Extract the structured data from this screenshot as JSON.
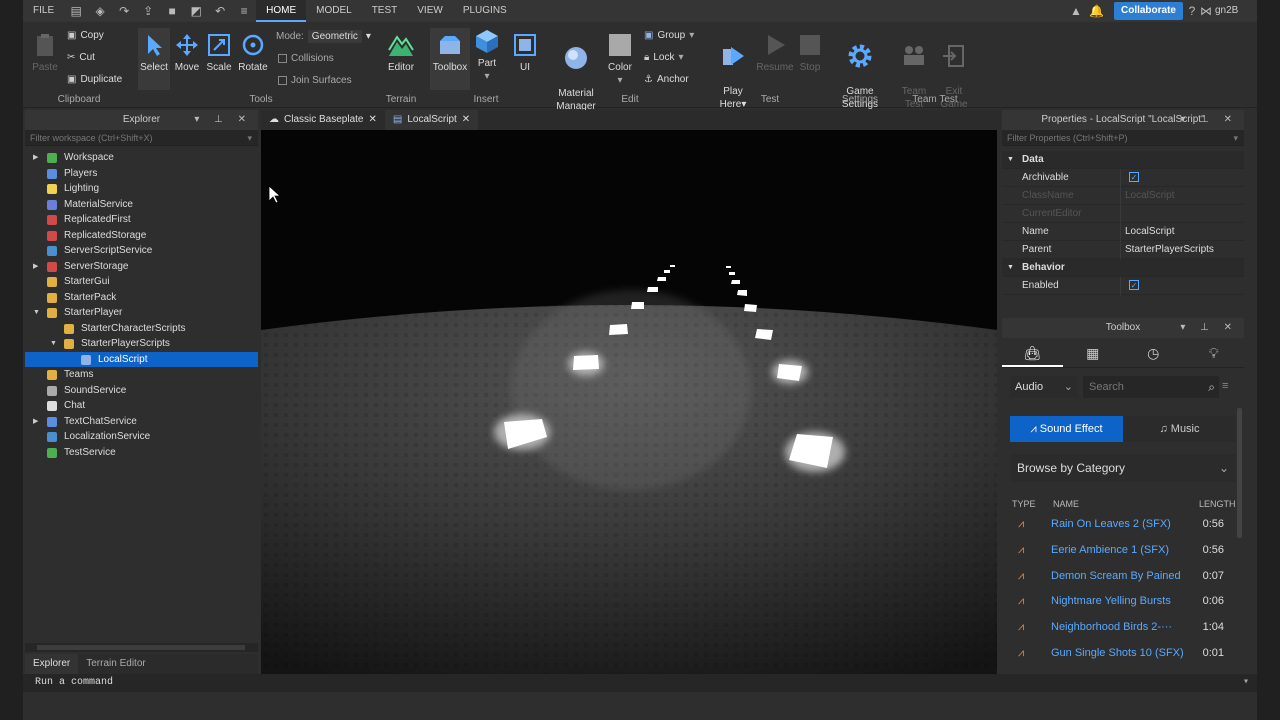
{
  "menu": {
    "items": [
      "FILE",
      "HOME",
      "MODEL",
      "TEST",
      "VIEW",
      "PLUGINS"
    ],
    "active": "HOME",
    "collaborate": "Collaborate",
    "user": "gn2B"
  },
  "ribbon": {
    "clipboard": {
      "label": "Clipboard",
      "paste": "Paste",
      "copy": "Copy",
      "cut": "Cut",
      "duplicate": "Duplicate"
    },
    "tools": {
      "label": "Tools",
      "select": "Select",
      "move": "Move",
      "scale": "Scale",
      "rotate": "Rotate",
      "mode_label": "Mode:",
      "mode_value": "Geometric",
      "collisions": "Collisions",
      "join_surfaces": "Join Surfaces"
    },
    "terrain": {
      "label": "Terrain",
      "editor": "Editor"
    },
    "insert": {
      "label": "Insert",
      "toolbox": "Toolbox",
      "part": "Part",
      "ui": "UI"
    },
    "edit": {
      "label": "Edit",
      "material": "Material\nManager",
      "color": "Color",
      "group": "Group",
      "lock": "Lock",
      "anchor": "Anchor"
    },
    "test": {
      "label": "Test",
      "play": "Play\nHere",
      "resume": "Resume",
      "stop": "Stop"
    },
    "settings": {
      "label": "Settings",
      "game_settings": "Game\nSettings"
    },
    "team_test": {
      "label": "Team Test",
      "team_test": "Team\nTest",
      "exit_game": "Exit\nGame"
    }
  },
  "explorer": {
    "title": "Explorer",
    "filter_placeholder": "Filter workspace (Ctrl+Shift+X)",
    "items": [
      {
        "label": "Workspace",
        "indent": 0,
        "arrow": "right",
        "color": "#4caf50"
      },
      {
        "label": "Players",
        "indent": 0,
        "arrow": "",
        "color": "#5b8de0"
      },
      {
        "label": "Lighting",
        "indent": 0,
        "arrow": "",
        "color": "#f0d050"
      },
      {
        "label": "MaterialService",
        "indent": 0,
        "arrow": "",
        "color": "#6a7fd8"
      },
      {
        "label": "ReplicatedFirst",
        "indent": 0,
        "arrow": "",
        "color": "#d04a4a"
      },
      {
        "label": "ReplicatedStorage",
        "indent": 0,
        "arrow": "",
        "color": "#d04a4a"
      },
      {
        "label": "ServerScriptService",
        "indent": 0,
        "arrow": "",
        "color": "#4a8fd0"
      },
      {
        "label": "ServerStorage",
        "indent": 0,
        "arrow": "right",
        "color": "#d04a4a"
      },
      {
        "label": "StarterGui",
        "indent": 0,
        "arrow": "",
        "color": "#e0b040"
      },
      {
        "label": "StarterPack",
        "indent": 0,
        "arrow": "",
        "color": "#e0b040"
      },
      {
        "label": "StarterPlayer",
        "indent": 0,
        "arrow": "down",
        "color": "#e0b040"
      },
      {
        "label": "StarterCharacterScripts",
        "indent": 1,
        "arrow": "",
        "color": "#e0b040"
      },
      {
        "label": "StarterPlayerScripts",
        "indent": 1,
        "arrow": "down",
        "color": "#e0b040"
      },
      {
        "label": "LocalScript",
        "indent": 2,
        "arrow": "",
        "color": "#8fb4e8",
        "selected": true
      },
      {
        "label": "Teams",
        "indent": 0,
        "arrow": "",
        "color": "#e0b040"
      },
      {
        "label": "SoundService",
        "indent": 0,
        "arrow": "",
        "color": "#aaaaaa"
      },
      {
        "label": "Chat",
        "indent": 0,
        "arrow": "",
        "color": "#dddddd"
      },
      {
        "label": "TextChatService",
        "indent": 0,
        "arrow": "right",
        "color": "#5b8de0"
      },
      {
        "label": "LocalizationService",
        "indent": 0,
        "arrow": "",
        "color": "#4a8fd0"
      },
      {
        "label": "TestService",
        "indent": 0,
        "arrow": "",
        "color": "#4caf50"
      }
    ],
    "bottom_tabs": [
      "Explorer",
      "Terrain Editor"
    ]
  },
  "editor_tabs": [
    {
      "label": "Classic Baseplate",
      "icon": "cloud-icon"
    },
    {
      "label": "LocalScript",
      "icon": "script-icon",
      "active": true
    }
  ],
  "properties": {
    "title": "Properties - LocalScript \"LocalScript\"",
    "filter_placeholder": "Filter Properties (Ctrl+Shift+P)",
    "rows": [
      {
        "type": "cat",
        "label": "Data"
      },
      {
        "type": "prop",
        "key": "Archivable",
        "value": "",
        "check": true
      },
      {
        "type": "prop",
        "key": "ClassName",
        "value": "LocalScript",
        "dim": true
      },
      {
        "type": "prop",
        "key": "CurrentEditor",
        "value": "",
        "dim": true
      },
      {
        "type": "prop",
        "key": "Name",
        "value": "LocalScript"
      },
      {
        "type": "prop",
        "key": "Parent",
        "value": "StarterPlayerScripts"
      },
      {
        "type": "cat",
        "label": "Behavior"
      },
      {
        "type": "prop",
        "key": "Enabled",
        "value": "",
        "check": true
      }
    ]
  },
  "toolbox": {
    "title": "Toolbox",
    "category": "Audio",
    "search_placeholder": "Search",
    "sound_effect": "Sound Effect",
    "music": "Music",
    "browse": "Browse by Category",
    "col_type": "TYPE",
    "col_name": "NAME",
    "col_length": "LENGTH",
    "sounds": [
      {
        "name": "Rain On Leaves 2 (SFX)",
        "length": "0:56"
      },
      {
        "name": "Eerie Ambience 1 (SFX)",
        "length": "0:56"
      },
      {
        "name": "Demon Scream By Pained",
        "length": "0:07"
      },
      {
        "name": "Nightmare Yelling Bursts",
        "length": "0:06"
      },
      {
        "name": "Neighborhood Birds 2-···",
        "length": "1:04"
      },
      {
        "name": "Gun Single Shots 10 (SFX)",
        "length": "0:01"
      }
    ]
  },
  "command_bar": {
    "placeholder": "Run a command"
  }
}
